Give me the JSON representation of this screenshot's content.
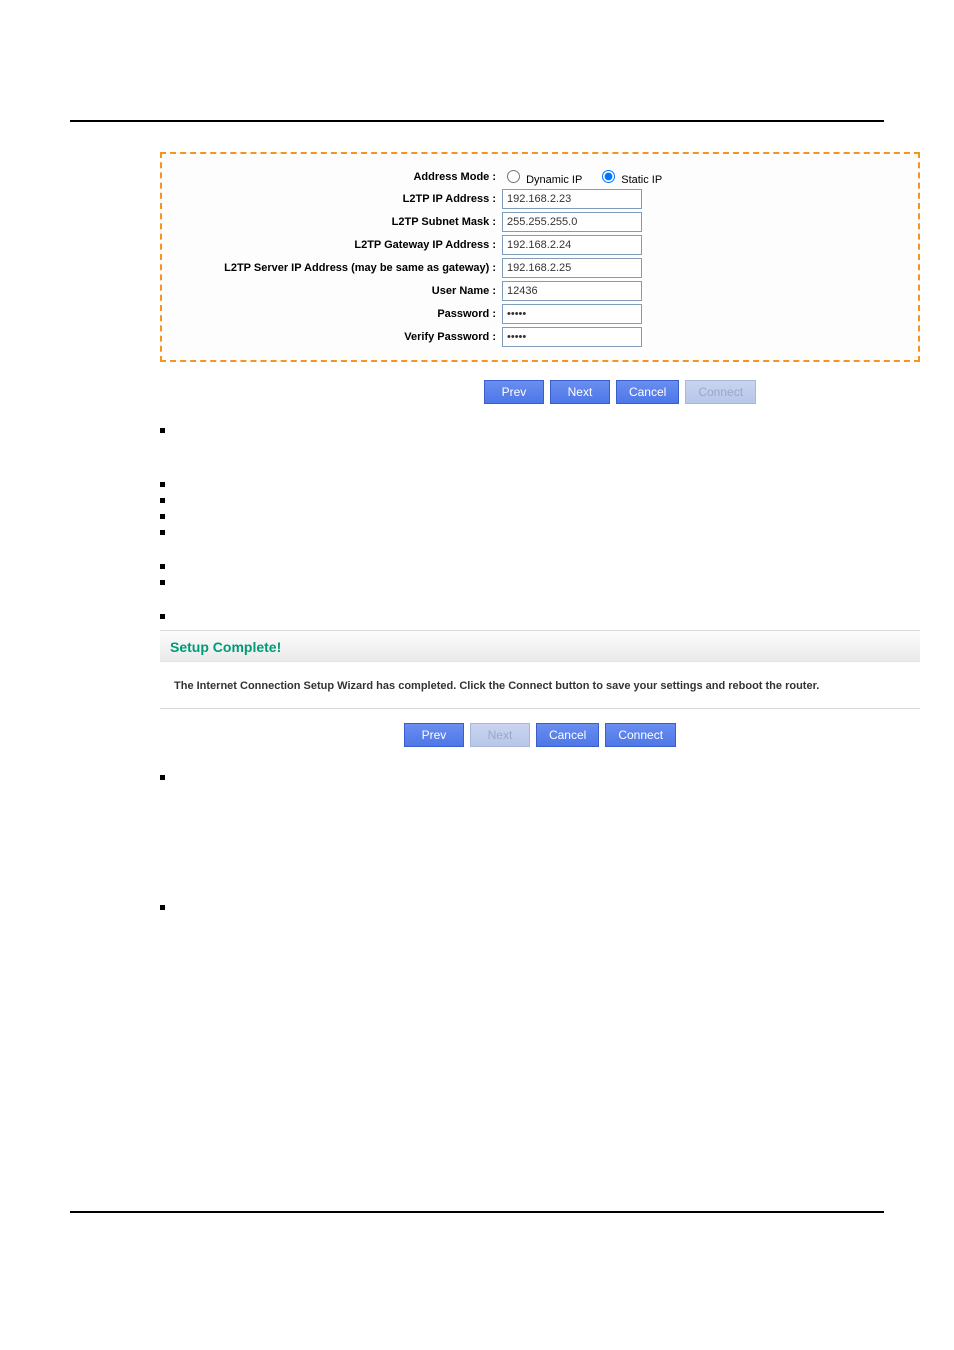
{
  "form": {
    "address_mode_label": "Address Mode :",
    "dynamic_ip_label": "Dynamic IP",
    "static_ip_label": "Static IP",
    "l2tp_ip_label": "L2TP IP Address :",
    "l2tp_ip_value": "192.168.2.23",
    "l2tp_subnet_label": "L2TP Subnet Mask :",
    "l2tp_subnet_value": "255.255.255.0",
    "l2tp_gateway_label": "L2TP Gateway IP Address :",
    "l2tp_gateway_value": "192.168.2.24",
    "l2tp_server_label": "L2TP Server IP Address (may be same as gateway) :",
    "l2tp_server_value": "192.168.2.25",
    "username_label": "User Name :",
    "username_value": "12436",
    "password_label": "Password :",
    "password_value": "•••••",
    "verify_password_label": "Verify Password :",
    "verify_password_value": "•••••"
  },
  "buttons1": {
    "prev": "Prev",
    "next": "Next",
    "cancel": "Cancel",
    "connect": "Connect"
  },
  "complete": {
    "title": "Setup Complete!",
    "body": "The Internet Connection Setup Wizard has completed. Click the Connect button to save your settings and reboot the router."
  },
  "buttons2": {
    "prev": "Prev",
    "next": "Next",
    "cancel": "Cancel",
    "connect": "Connect"
  }
}
